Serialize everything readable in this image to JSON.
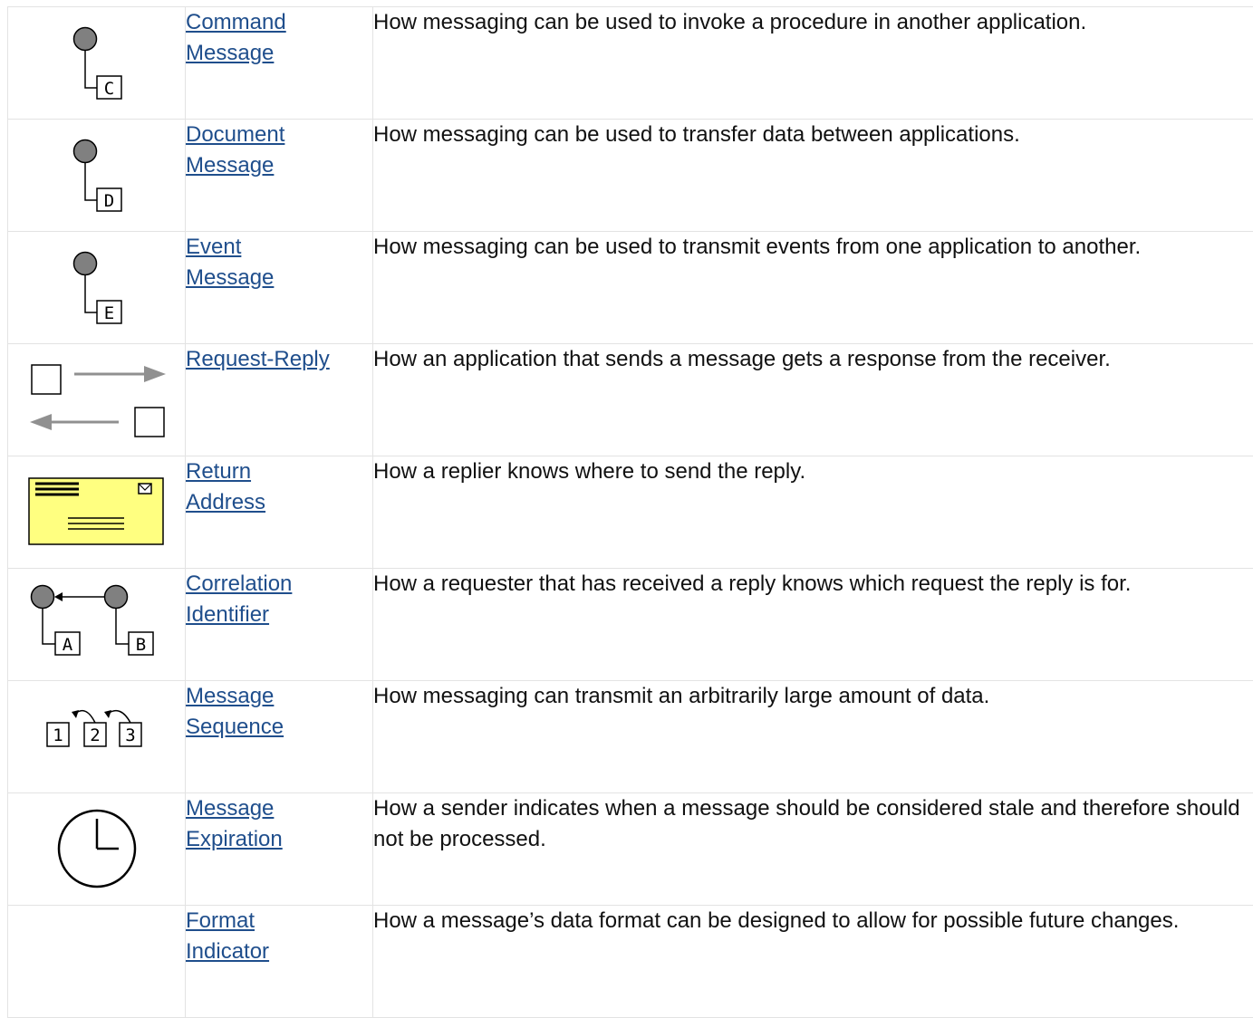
{
  "rows": [
    {
      "icon": "command-message-icon",
      "name": [
        "Command",
        "Message"
      ],
      "description": "How messaging can be used to invoke a procedure in another application."
    },
    {
      "icon": "document-message-icon",
      "name": [
        "Document",
        "Message"
      ],
      "description": "How messaging can be used to transfer data between applications."
    },
    {
      "icon": "event-message-icon",
      "name": [
        "Event",
        "Message"
      ],
      "description": "How messaging can be used to transmit events from one application to another."
    },
    {
      "icon": "request-reply-icon",
      "name": [
        "Request-Reply"
      ],
      "description": "How an application that sends a message gets a response from the receiver."
    },
    {
      "icon": "return-address-icon",
      "name": [
        "Return",
        "Address"
      ],
      "description": "How a replier knows where to send the reply."
    },
    {
      "icon": "correlation-identifier-icon",
      "name": [
        "Correlation",
        "Identifier"
      ],
      "description": "How a requester that has received a reply knows which request the reply is for."
    },
    {
      "icon": "message-sequence-icon",
      "name": [
        "Message",
        "Sequence"
      ],
      "description": "How messaging can transmit an arbitrarily large amount of data."
    },
    {
      "icon": "message-expiration-icon",
      "name": [
        "Message",
        "Expiration"
      ],
      "description": "How a sender indicates when a message should be considered stale and therefore should not be processed."
    },
    {
      "icon": "",
      "name": [
        "Format",
        "Indicator"
      ],
      "description": "How a message’s data format can be designed to allow for possible future changes."
    }
  ],
  "icon_letters": {
    "command": "C",
    "document": "D",
    "event": "E",
    "correlation_a": "A",
    "correlation_b": "B",
    "sequence": [
      "1",
      "2",
      "3"
    ]
  },
  "colors": {
    "link": "#1f4e8c",
    "circle_fill": "#808080",
    "envelope_fill": "#ffff80",
    "arrow_gray": "#909090",
    "grid": "#e3e3e3"
  }
}
